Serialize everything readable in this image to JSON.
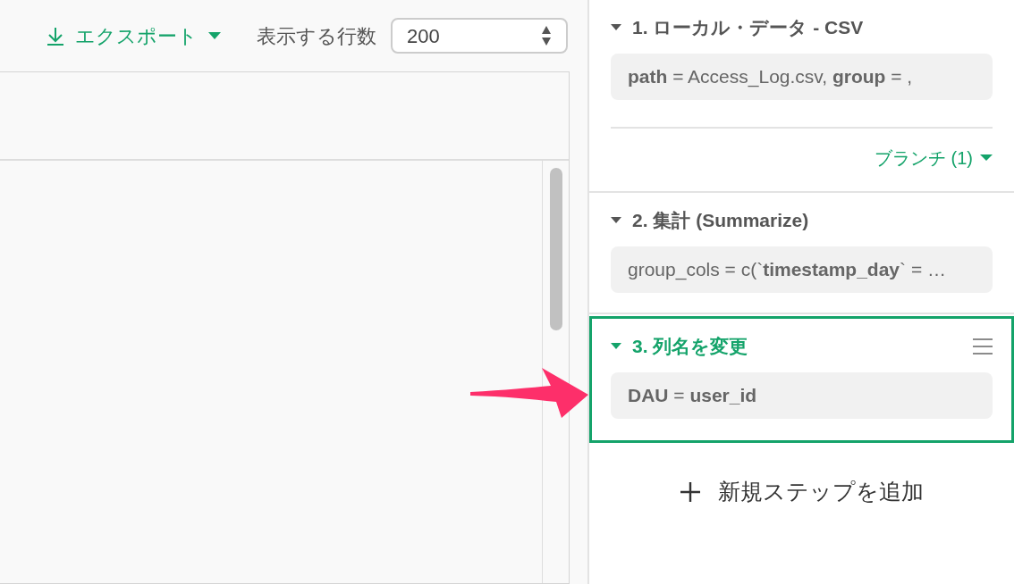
{
  "toolbar": {
    "export_label": "エクスポート",
    "rows_label": "表示する行数",
    "rows_value": "200"
  },
  "steps": [
    {
      "title": "1. ローカル・データ - CSV",
      "params": "**path** = Access_Log.csv, **group** = ,",
      "selected": false,
      "branch": "ブランチ (1)"
    },
    {
      "title": "2. 集計 (Summarize)",
      "params": "group_cols = c(`**timestamp_day**` = …",
      "selected": false
    },
    {
      "title": "3. 列名を変更",
      "params": "**DAU** = **user_id**",
      "selected": true
    }
  ],
  "add_step": "新規ステップを追加"
}
